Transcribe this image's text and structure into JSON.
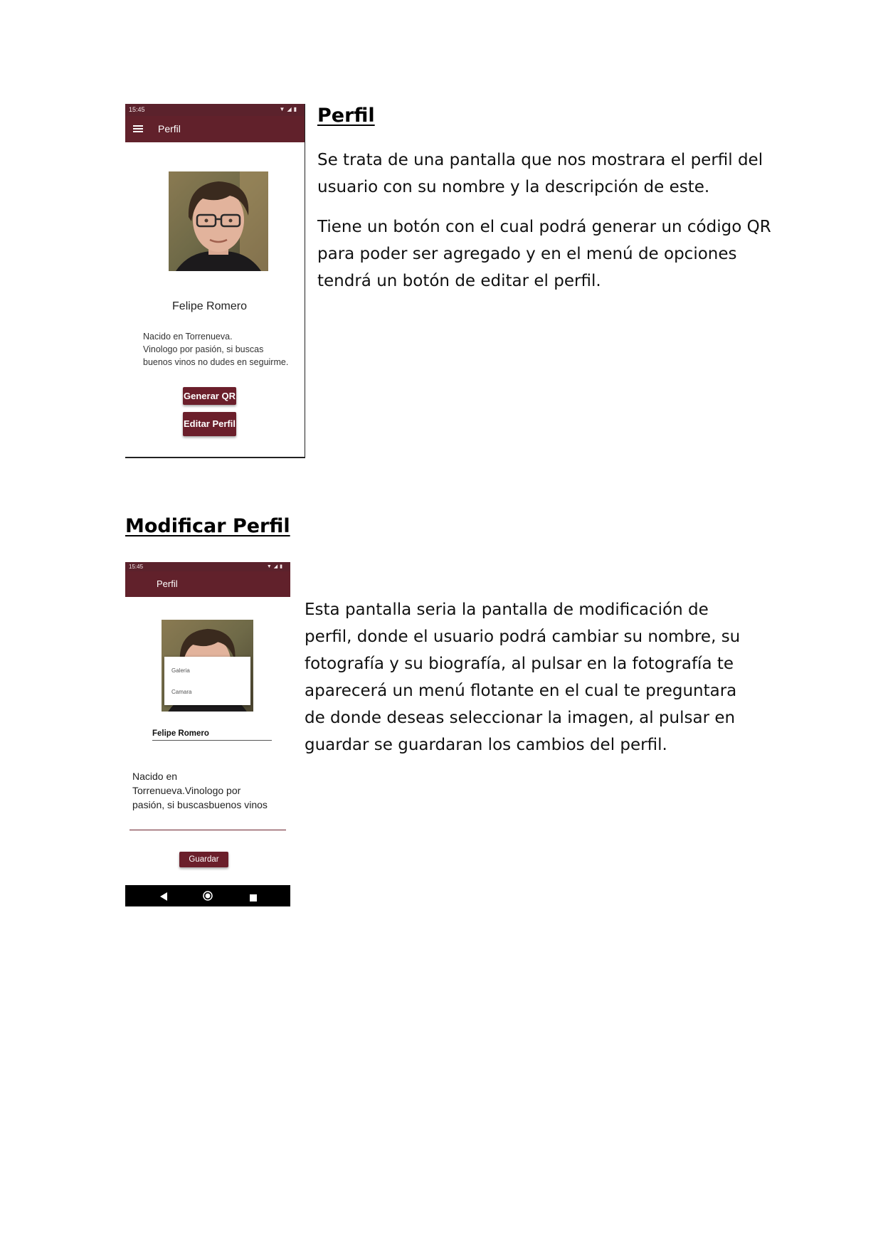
{
  "section1": {
    "heading": "Perfil",
    "paragraphs": [
      "Se trata de una pantalla que nos mostrara el perfil del usuario con su nombre y la descripción de este.",
      "Tiene un botón con el cual podrá generar un código QR para poder ser agregado y en el menú de opciones tendrá un botón de editar el perfil."
    ],
    "phone": {
      "time": "15:45",
      "status_icons": [
        "wifi-icon",
        "signal-icon",
        "battery-icon"
      ],
      "toolbar_title": "Perfil",
      "menu_icon": "hamburger-menu-icon",
      "user_name": "Felipe Romero",
      "bio_lines": [
        "Nacido en Torrenueva.",
        "Vinologo por pasión, si buscas",
        "buenos vinos no dudes en seguirme."
      ],
      "generate_qr_label": "Generar QR",
      "edit_profile_label": "Editar Perfil"
    }
  },
  "section2": {
    "heading": "Modificar Perfil",
    "paragraph": "Esta pantalla seria la pantalla de modificación de perfil, donde el usuario podrá cambiar su nombre, su fotografía y su biografía, al pulsar en la fotografía te aparecerá un menú flotante en el cual te preguntara de donde deseas seleccionar la imagen, al pulsar en guardar se guardaran los cambios del perfil.",
    "phone": {
      "time": "15:45",
      "status_icons": [
        "wifi-icon",
        "signal-icon",
        "battery-icon"
      ],
      "toolbar_title": "Perfil",
      "popup_options": [
        "Galeria",
        "Camara"
      ],
      "name_value": "Felipe Romero",
      "bio_lines": [
        "Nacido en",
        "Torrenueva.Vinologo por",
        "pasión, si buscasbuenos vinos"
      ],
      "save_label": "Guardar",
      "nav_icons": [
        "back-icon",
        "home-icon",
        "recents-icon"
      ]
    }
  },
  "colors": {
    "toolbar": "#61212b",
    "button": "#6b1f2b",
    "status_bar": "#5b222c"
  }
}
